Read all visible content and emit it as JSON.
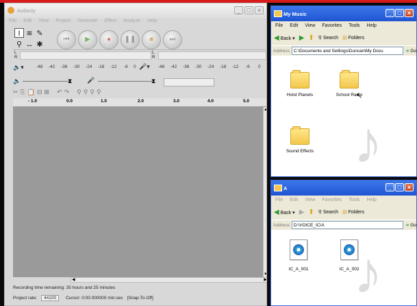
{
  "audacity": {
    "title": "Audacity",
    "menu": [
      "File",
      "Edit",
      "View",
      "Project",
      "Generate",
      "Effect",
      "Analyze",
      "Help"
    ],
    "transport_icons": [
      "skip-start-icon",
      "play-icon",
      "record-icon",
      "pause-icon",
      "stop-icon",
      "skip-end-icon"
    ],
    "meter_scale_left": [
      "-48",
      "-42",
      "-36",
      "-30",
      "-24",
      "-18",
      "-12",
      "-6",
      "0"
    ],
    "meter_scale_right": [
      "-48",
      "-42",
      "-36",
      "-30",
      "-24",
      "-18",
      "-12",
      "-6",
      "0"
    ],
    "meter_channels": "L\nR",
    "ruler": [
      "- 1.0",
      "0.0",
      "1.0",
      "2.0",
      "3.0",
      "4.0",
      "5.0"
    ],
    "status": "Recording time remaining: 35 hours and 25 minutes",
    "project_rate_label": "Project rate:",
    "project_rate": "44100",
    "cursor": "Cursor: 0:00.000000 min:sec",
    "snap": "[Snap-To Off]"
  },
  "mymusic": {
    "title": "My Music",
    "menu": [
      "File",
      "Edit",
      "View",
      "Favorites",
      "Tools",
      "Help"
    ],
    "back": "Back",
    "search": "Search",
    "folders": "Folders",
    "address_label": "Address",
    "address": "C:\\Documents and Settings\\Duncan\\My Docu",
    "go": "Go",
    "items": [
      "Holst Planets",
      "School Radio",
      "Sound Effects"
    ]
  },
  "a_window": {
    "title": "A",
    "menu": [
      "File",
      "Edit",
      "View",
      "Favorites",
      "Tools",
      "Help"
    ],
    "back": "Back",
    "search": "Search",
    "folders": "Folders",
    "address_label": "Address",
    "address": "D:\\VOICE_IC\\A",
    "go": "Go",
    "items": [
      "IC_A_001",
      "IC_A_002"
    ]
  }
}
